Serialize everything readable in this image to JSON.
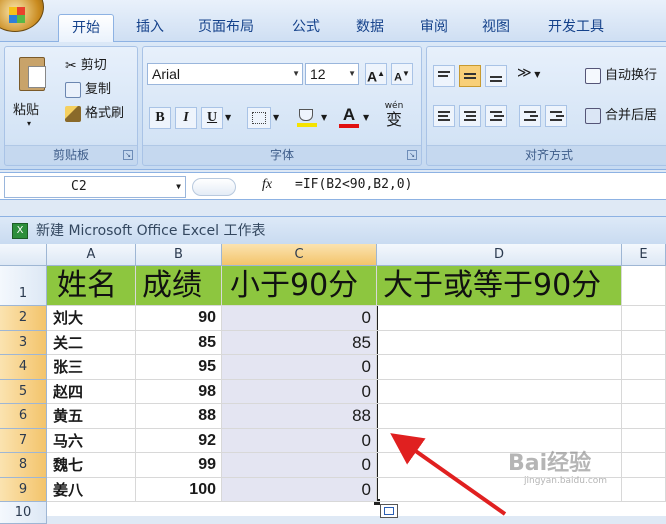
{
  "ribbon": {
    "tabs": [
      {
        "label": "开始",
        "active": true
      },
      {
        "label": "插入"
      },
      {
        "label": "页面布局"
      },
      {
        "label": "公式"
      },
      {
        "label": "数据"
      },
      {
        "label": "审阅"
      },
      {
        "label": "视图"
      },
      {
        "label": "开发工具"
      }
    ],
    "clipboard": {
      "paste": "粘贴",
      "cut": "剪切",
      "copy": "复制",
      "format_painter": "格式刷",
      "group_label": "剪贴板"
    },
    "font": {
      "font_name": "Arial",
      "font_size": "12",
      "grow": "A",
      "shrink": "A",
      "bold": "B",
      "italic": "I",
      "underline": "U",
      "font_color_glyph": "A",
      "phonetic": "wén",
      "phonetic_char": "变",
      "group_label": "字体"
    },
    "alignment": {
      "wrap_text": "自动换行",
      "merge_center": "合并后居",
      "group_label": "对齐方式"
    }
  },
  "formula_bar": {
    "name_box": "C2",
    "fx": "fx",
    "formula": "=IF(B2<90,B2,0)"
  },
  "workbook": {
    "title": "新建 Microsoft Office Excel 工作表"
  },
  "sheet": {
    "columns": [
      "A",
      "B",
      "C",
      "D",
      "E"
    ],
    "header_row": [
      "姓名",
      "成绩",
      "小于90分",
      "大于或等于90分"
    ],
    "rows": [
      {
        "row": "2",
        "name": "刘大",
        "score": "90",
        "result": "0"
      },
      {
        "row": "3",
        "name": "关二",
        "score": "85",
        "result": "85"
      },
      {
        "row": "4",
        "name": "张三",
        "score": "95",
        "result": "0"
      },
      {
        "row": "5",
        "name": "赵四",
        "score": "98",
        "result": "0"
      },
      {
        "row": "6",
        "name": "黄五",
        "score": "88",
        "result": "88"
      },
      {
        "row": "7",
        "name": "马六",
        "score": "92",
        "result": "0"
      },
      {
        "row": "8",
        "name": "魏七",
        "score": "99",
        "result": "0"
      },
      {
        "row": "9",
        "name": "姜八",
        "score": "100",
        "result": "0"
      }
    ],
    "row_numbers": [
      "1",
      "10"
    ]
  },
  "watermark": {
    "text": "Bai经验",
    "sub": "jingyan.baidu.com"
  },
  "colors": {
    "header_fill": "#8dc63f",
    "selection_fill": "#e4e5f2",
    "arrow": "#e02020"
  }
}
